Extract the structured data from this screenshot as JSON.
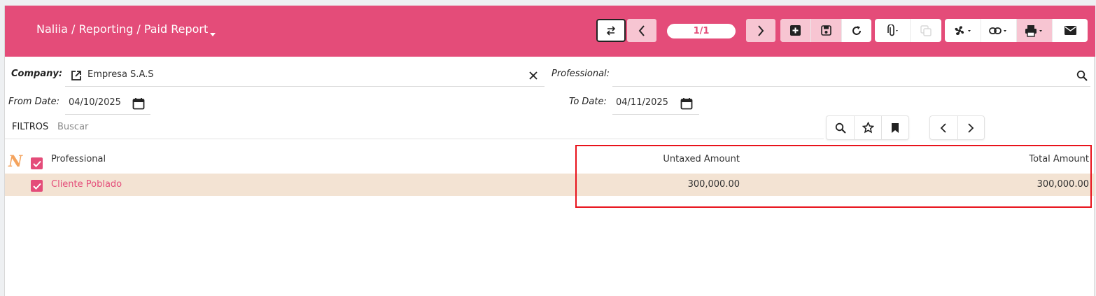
{
  "header": {
    "breadcrumb": "Naliia / Reporting / Paid Report",
    "pager": "1/1",
    "colors": {
      "primary": "#e44c79",
      "button_pink": "#f7c5d2"
    },
    "toolbar_icons": [
      "swap-arrows-icon",
      "chevron-left-icon",
      "chevron-right-icon",
      "plus-square-icon",
      "save-icon",
      "refresh-icon",
      "paperclip-icon",
      "copy-icon",
      "fan-icon",
      "link-icon",
      "printer-icon",
      "envelope-icon"
    ]
  },
  "form": {
    "company_label": "Company:",
    "company_value": "Empresa S.A.S",
    "professional_label": "Professional:",
    "from_date_label": "From Date:",
    "from_date_value": "04/10/2025",
    "to_date_label": "To Date:",
    "to_date_value": "04/11/2025"
  },
  "filters": {
    "label": "FILTROS",
    "placeholder": "Buscar"
  },
  "table": {
    "logo_letter": "N",
    "columns": [
      "Professional",
      "Untaxed Amount",
      "Total Amount"
    ],
    "rows": [
      {
        "professional": "Cliente Poblado",
        "untaxed": "300,000.00",
        "total": "300,000.00"
      }
    ]
  },
  "highlight_color": "#e8131c"
}
